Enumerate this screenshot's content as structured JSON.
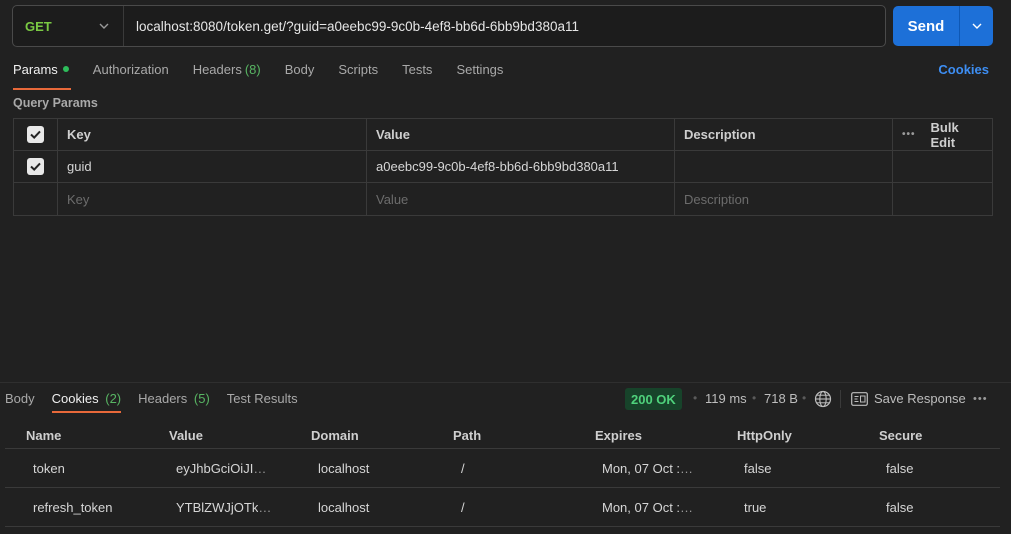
{
  "request": {
    "method": "GET",
    "url": "localhost:8080/token.get/?guid=a0eebc99-9c0b-4ef8-bb6d-6bb9bd380a11",
    "send_label": "Send"
  },
  "request_tabs": [
    {
      "label": "Params",
      "active": true
    },
    {
      "label": "Authorization"
    },
    {
      "label": "Headers",
      "count": "(8)"
    },
    {
      "label": "Body"
    },
    {
      "label": "Scripts"
    },
    {
      "label": "Tests"
    },
    {
      "label": "Settings"
    }
  ],
  "cookies_link": "Cookies",
  "query_params": {
    "title": "Query Params",
    "headers": {
      "key": "Key",
      "value": "Value",
      "description": "Description",
      "bulk_edit": "Bulk Edit"
    },
    "rows": [
      {
        "checked": true,
        "key": "guid",
        "value": "a0eebc99-9c0b-4ef8-bb6d-6bb9bd380a11",
        "description": ""
      }
    ],
    "placeholders": {
      "key": "Key",
      "value": "Value",
      "description": "Description"
    }
  },
  "response_tabs": [
    {
      "label": "Body"
    },
    {
      "label": "Cookies",
      "count": "(2)",
      "active": true
    },
    {
      "label": "Headers",
      "count": "(5)"
    },
    {
      "label": "Test Results"
    }
  ],
  "response_meta": {
    "status": "200 OK",
    "time": "119 ms",
    "size": "718 B",
    "save_label": "Save Response"
  },
  "cookies": {
    "headers": [
      "Name",
      "Value",
      "Domain",
      "Path",
      "Expires",
      "HttpOnly",
      "Secure"
    ],
    "rows": [
      {
        "name": "token",
        "value": "eyJhbGciOiJI",
        "domain": "localhost",
        "path": "/",
        "expires": "Mon, 07 Oct :",
        "httponly": "false",
        "secure": "false"
      },
      {
        "name": "refresh_token",
        "value": "YTBlZWJjOTk",
        "domain": "localhost",
        "path": "/",
        "expires": "Mon, 07 Oct :",
        "httponly": "true",
        "secure": "false"
      }
    ]
  },
  "colors": {
    "method_get": "#7ac943",
    "send_button": "#1d70d8",
    "active_tab_underline": "#e8693a",
    "status_ok": "#4fd27c",
    "link": "#3d8ef3"
  }
}
